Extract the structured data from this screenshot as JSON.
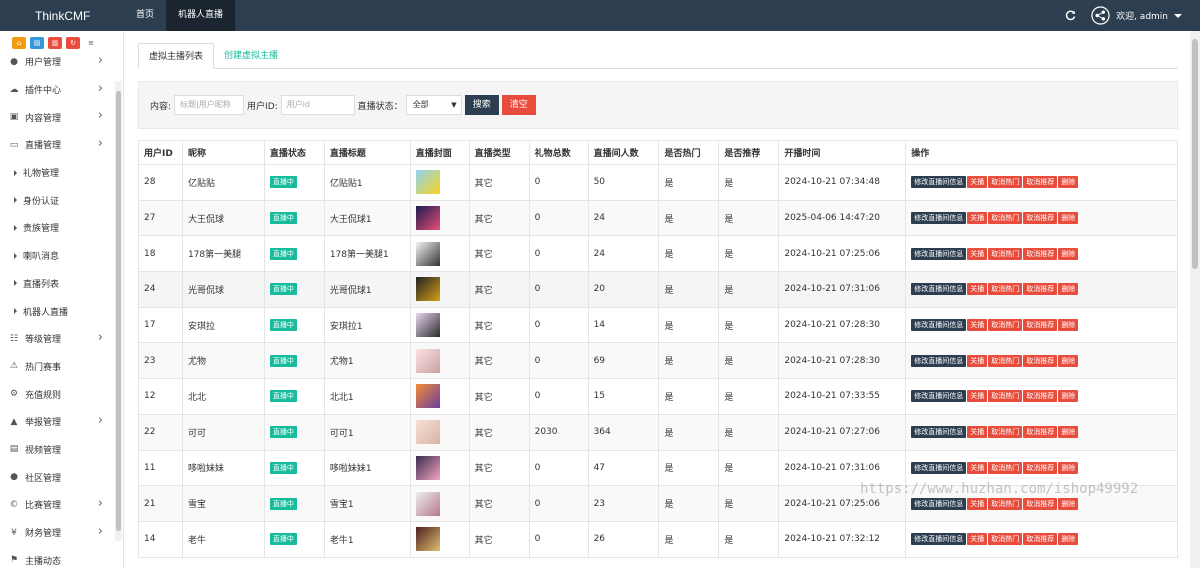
{
  "brand": "ThinkCMF",
  "topnav": [
    {
      "label": "首页",
      "active": false
    },
    {
      "label": "机器人直播",
      "active": true
    }
  ],
  "welcome": "欢迎, admin",
  "sidebar": {
    "quick_icons": [
      "home-icon",
      "file-icon",
      "trash-icon",
      "refresh-icon",
      "list-icon"
    ],
    "items": [
      {
        "label": "用户管理",
        "icon": "user-icon",
        "chevron": true,
        "sub": false
      },
      {
        "label": "插件中心",
        "icon": "cloud-icon",
        "chevron": true,
        "sub": false
      },
      {
        "label": "内容管理",
        "icon": "inbox-icon",
        "chevron": true,
        "sub": false
      },
      {
        "label": "直播管理",
        "icon": "monitor-icon",
        "chevron": true,
        "sub": false
      },
      {
        "label": "礼物管理",
        "sub": true
      },
      {
        "label": "身份认证",
        "sub": true
      },
      {
        "label": "贵族管理",
        "sub": true
      },
      {
        "label": "喇叭消息",
        "sub": true
      },
      {
        "label": "直播列表",
        "sub": true
      },
      {
        "label": "机器人直播",
        "sub": true
      },
      {
        "label": "等级管理",
        "icon": "sitemap-icon",
        "chevron": true,
        "sub": false
      },
      {
        "label": "热门赛事",
        "icon": "warning-icon",
        "chevron": false,
        "sub": false
      },
      {
        "label": "充值规则",
        "icon": "gears-icon",
        "chevron": false,
        "sub": false
      },
      {
        "label": "举报管理",
        "icon": "alert-icon",
        "chevron": true,
        "sub": false
      },
      {
        "label": "视频管理",
        "icon": "video-file-icon",
        "chevron": false,
        "sub": false
      },
      {
        "label": "社区管理",
        "icon": "comment-icon",
        "chevron": false,
        "sub": false
      },
      {
        "label": "比赛管理",
        "icon": "copyright-icon",
        "chevron": true,
        "sub": false
      },
      {
        "label": "财务管理",
        "icon": "yen-icon",
        "chevron": true,
        "sub": false
      },
      {
        "label": "主播动态",
        "icon": "flag-icon",
        "chevron": false,
        "sub": false
      }
    ]
  },
  "tabs": [
    {
      "label": "虚拟主播列表",
      "active": true
    },
    {
      "label": "创建虚拟主播",
      "active": false
    }
  ],
  "filter": {
    "content_label": "内容:",
    "content_placeholder": "标题|用户昵称",
    "userid_label": "用户ID:",
    "userid_placeholder": "用户id",
    "status_label": "直播状态：",
    "status_value": "全部",
    "search_label": "搜索",
    "clear_label": "清空"
  },
  "table": {
    "headers": [
      "用户ID",
      "昵称",
      "直播状态",
      "直播标题",
      "直播封面",
      "直播类型",
      "礼物总数",
      "直播间人数",
      "是否热门",
      "是否推荐",
      "开播时间",
      "操作"
    ],
    "status_text": "直播中",
    "actions": [
      "修改直播间信息",
      "关播",
      "取消热门",
      "取消推荐",
      "删除"
    ],
    "rows": [
      {
        "id": "28",
        "nick": "亿贴贴",
        "title": "亿贴贴1",
        "type": "其它",
        "gifts": "0",
        "viewers": "50",
        "hot": "是",
        "rec": "是",
        "time": "2024-10-21 07:34:48",
        "cover": [
          "#8fd3f4",
          "#f9d423"
        ]
      },
      {
        "id": "27",
        "nick": "大王侃球",
        "title": "大王侃球1",
        "type": "其它",
        "gifts": "0",
        "viewers": "24",
        "hot": "是",
        "rec": "是",
        "time": "2025-04-06 14:47:20",
        "cover": [
          "#1b1b4f",
          "#e94e77"
        ]
      },
      {
        "id": "18",
        "nick": "178第一美腿",
        "title": "178第一美腿1",
        "type": "其它",
        "gifts": "0",
        "viewers": "24",
        "hot": "是",
        "rec": "是",
        "time": "2024-10-21 07:25:06",
        "cover": [
          "#f5f5f5",
          "#333333"
        ]
      },
      {
        "id": "24",
        "nick": "光哥侃球",
        "title": "光哥侃球1",
        "type": "其它",
        "gifts": "0",
        "viewers": "20",
        "hot": "是",
        "rec": "是",
        "time": "2024-10-21 07:31:06",
        "cover": [
          "#222222",
          "#d4a017"
        ]
      },
      {
        "id": "17",
        "nick": "安琪拉",
        "title": "安琪拉1",
        "type": "其它",
        "gifts": "0",
        "viewers": "14",
        "hot": "是",
        "rec": "是",
        "time": "2024-10-21 07:28:30",
        "cover": [
          "#e8d5f0",
          "#2c2c2c"
        ]
      },
      {
        "id": "23",
        "nick": "尤物",
        "title": "尤物1",
        "type": "其它",
        "gifts": "0",
        "viewers": "69",
        "hot": "是",
        "rec": "是",
        "time": "2024-10-21 07:28:30",
        "cover": [
          "#fde2e4",
          "#c9a0a0"
        ]
      },
      {
        "id": "12",
        "nick": "北北",
        "title": "北北1",
        "type": "其它",
        "gifts": "0",
        "viewers": "15",
        "hot": "是",
        "rec": "是",
        "time": "2024-10-21 07:33:55",
        "cover": [
          "#f28c38",
          "#6a3d9a"
        ]
      },
      {
        "id": "22",
        "nick": "可可",
        "title": "可可1",
        "type": "其它",
        "gifts": "2030",
        "viewers": "364",
        "hot": "是",
        "rec": "是",
        "time": "2024-10-21 07:27:06",
        "cover": [
          "#f6e0d6",
          "#d9b3a3"
        ]
      },
      {
        "id": "11",
        "nick": "哆啦妹妹",
        "title": "哆啦妹妹1",
        "type": "其它",
        "gifts": "0",
        "viewers": "47",
        "hot": "是",
        "rec": "是",
        "time": "2024-10-21 07:31:06",
        "cover": [
          "#3b2c4f",
          "#f4a6c1"
        ]
      },
      {
        "id": "21",
        "nick": "雪宝",
        "title": "雪宝1",
        "type": "其它",
        "gifts": "0",
        "viewers": "23",
        "hot": "是",
        "rec": "是",
        "time": "2024-10-21 07:25:06",
        "cover": [
          "#eeeeee",
          "#b57a8a"
        ]
      },
      {
        "id": "14",
        "nick": "老牛",
        "title": "老牛1",
        "type": "其它",
        "gifts": "0",
        "viewers": "26",
        "hot": "是",
        "rec": "是",
        "time": "2024-10-21 07:32:12",
        "cover": [
          "#4a1f1f",
          "#e0c070"
        ]
      }
    ]
  },
  "watermark": "https://www.huzhan.com/ishop49992"
}
